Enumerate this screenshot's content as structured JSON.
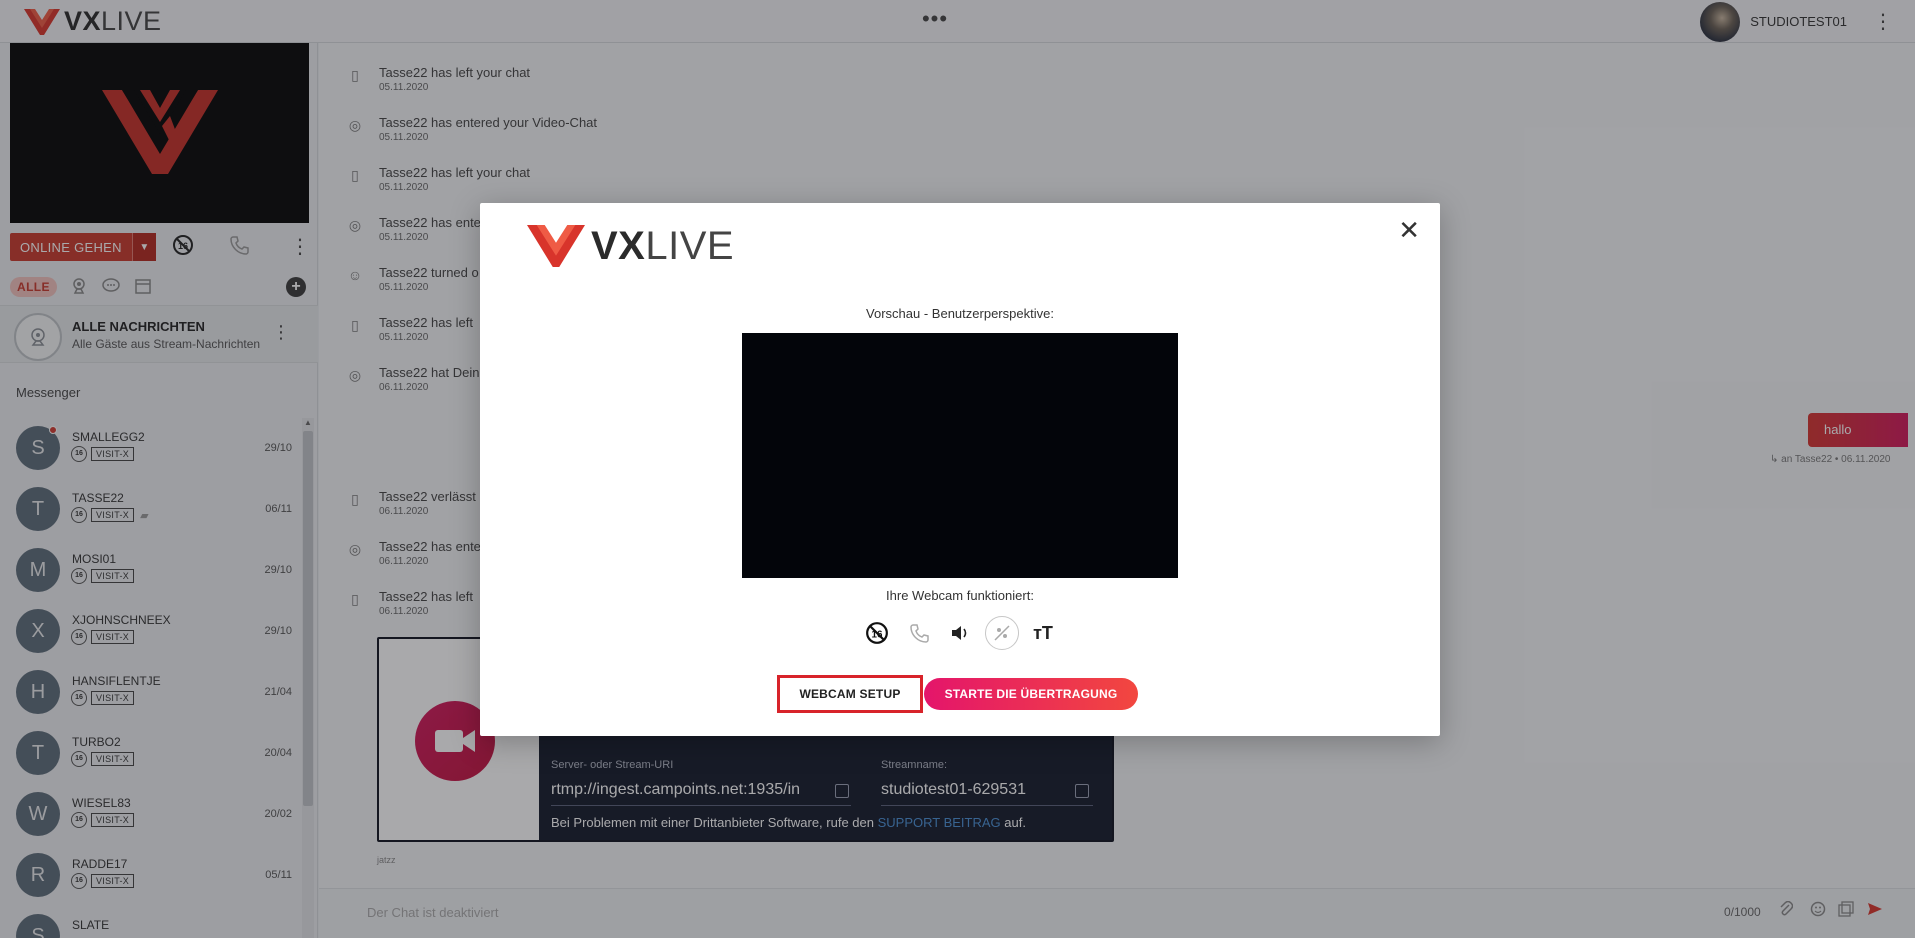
{
  "topbar": {
    "brand_bold": "VX",
    "brand_thin": "LIVE",
    "center_menu": "•••",
    "user_name": "STUDIOTEST01",
    "menu": "⋮"
  },
  "sidebar": {
    "online_label": "ONLINE GEHEN",
    "online_caret": "▼",
    "kebab": "⋮",
    "filter_all": "ALLE",
    "add": "+",
    "all_messages": {
      "title": "ALLE NACHRICHTEN",
      "subtitle": "Alle Gäste aus Stream-Nachrichten",
      "kebab": "⋮"
    },
    "messenger_title": "Messenger",
    "contacts": [
      {
        "initial": "S",
        "name": "SMALLEGG2",
        "tag": "VISIT-X",
        "date": "29/10",
        "unread": true,
        "chat": false
      },
      {
        "initial": "T",
        "name": "TASSE22",
        "tag": "VISIT-X",
        "date": "06/11",
        "unread": false,
        "chat": true
      },
      {
        "initial": "M",
        "name": "MOSI01",
        "tag": "VISIT-X",
        "date": "29/10",
        "unread": false,
        "chat": false
      },
      {
        "initial": "X",
        "name": "XJOHNSCHNEEX",
        "tag": "VISIT-X",
        "date": "29/10",
        "unread": false,
        "chat": false
      },
      {
        "initial": "H",
        "name": "HANSIFLENTJE",
        "tag": "VISIT-X",
        "date": "21/04",
        "unread": false,
        "chat": false
      },
      {
        "initial": "T",
        "name": "TURBO2",
        "tag": "VISIT-X",
        "date": "20/04",
        "unread": false,
        "chat": false
      },
      {
        "initial": "W",
        "name": "WIESEL83",
        "tag": "VISIT-X",
        "date": "20/02",
        "unread": false,
        "chat": false
      },
      {
        "initial": "R",
        "name": "RADDE17",
        "tag": "VISIT-X",
        "date": "05/11",
        "unread": false,
        "chat": false
      },
      {
        "initial": "S",
        "name": "SLATE",
        "tag": "",
        "date": "",
        "unread": false,
        "chat": false
      }
    ]
  },
  "chat": {
    "events": [
      {
        "icon": "door-icon",
        "text": "Tasse22 has left your chat",
        "date": "05.11.2020"
      },
      {
        "icon": "webcam-icon",
        "text": "Tasse22 has entered your Video-Chat",
        "date": "05.11.2020"
      },
      {
        "icon": "door-icon",
        "text": "Tasse22 has left your chat",
        "date": "05.11.2020"
      },
      {
        "icon": "webcam-icon",
        "text": "Tasse22 has ente",
        "date": "05.11.2020"
      },
      {
        "icon": "smiley-icon",
        "text": "Tasse22 turned o",
        "date": "05.11.2020"
      },
      {
        "icon": "door-icon",
        "text": "Tasse22 has left",
        "date": "05.11.2020"
      },
      {
        "icon": "webcam-icon",
        "text": "Tasse22 hat Dein",
        "date": "06.11.2020"
      },
      {
        "icon": "door-icon",
        "text": "Tasse22 verlässt",
        "date": "06.11.2020"
      },
      {
        "icon": "webcam-icon",
        "text": "Tasse22 has ente",
        "date": "06.11.2020"
      },
      {
        "icon": "door-icon",
        "text": "Tasse22 has left",
        "date": "06.11.2020"
      }
    ],
    "bubble": "hallo",
    "bubble_meta": "↳  an Tasse22 • 06.11.2020",
    "stream": {
      "server_label": "Server- oder Stream-URI",
      "server_value": "rtmp://ingest.campoints.net:1935/in",
      "name_label": "Streamname:",
      "name_value": "studiotest01-629531",
      "help_prefix": "Bei Problemen mit einer Drittanbieter Software, rufe den ",
      "help_link": "SUPPORT BEITRAG",
      "help_suffix": " auf."
    },
    "footnote": "jatzz",
    "composer_placeholder": "Der Chat ist deaktiviert",
    "counter": "0/1000"
  },
  "modal": {
    "close": "✕",
    "brand_bold": "VX",
    "brand_thin": "LIVE",
    "preview_label": "Vorschau - Benutzerperspektive:",
    "webcam_ok": "Ihre Webcam funktioniert:",
    "text_size_icon": "тT",
    "setup_button": "WEBCAM SETUP",
    "start_button": "STARTE DIE ÜBERTRAGUNG"
  }
}
